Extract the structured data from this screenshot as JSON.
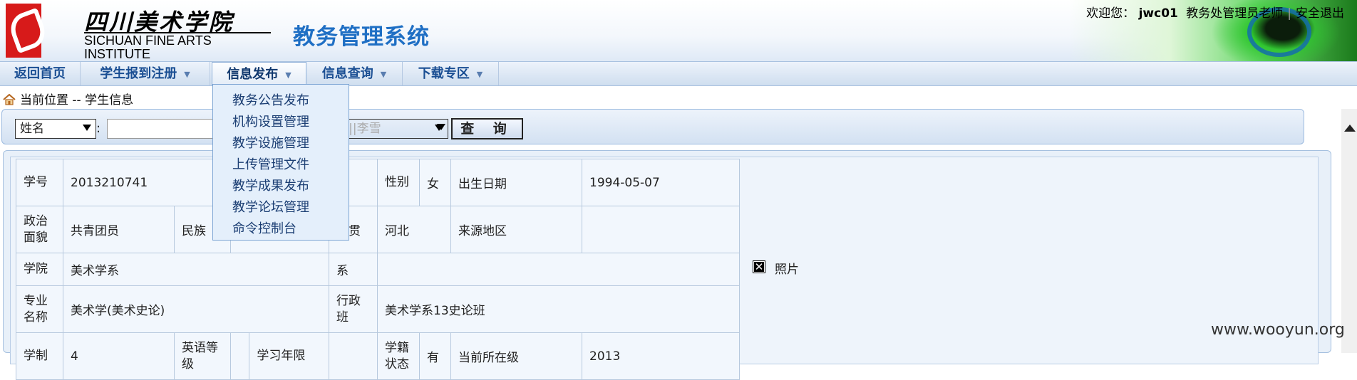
{
  "header": {
    "logo_cn": "四川美术学院",
    "logo_en": "SICHUAN FINE ARTS INSTITUTE",
    "system_title": "教务管理系统",
    "welcome_label": "欢迎您：",
    "user_name": "jwc01",
    "user_role": "教务处管理员老师",
    "separator": "|",
    "logout": "安全退出"
  },
  "nav": {
    "items": [
      {
        "label": "返回首页"
      },
      {
        "label": "学生报到注册",
        "arrow": "▼"
      },
      {
        "label": "信息发布",
        "arrow": "▼"
      },
      {
        "label": "信息查询",
        "arrow": "▼"
      },
      {
        "label": "下载专区",
        "arrow": "▼"
      }
    ]
  },
  "dropdown": {
    "items": [
      "教务公告发布",
      "机构设置管理",
      "教学设施管理",
      "上传管理文件",
      "教学成果发布",
      "教学论坛管理",
      "命令控制台"
    ]
  },
  "breadcrumb": "当前位置 -- 学生信息",
  "search": {
    "field_select": "姓名",
    "colon": ":",
    "student_select": "2013210741||李雪",
    "query_button": "查 询"
  },
  "student": {
    "rows": [
      [
        "学号",
        "2013210741",
        "",
        "性别",
        "女",
        "出生日期",
        "1994-05-07"
      ],
      [
        "政治面貌",
        "共青团员",
        "民族",
        "",
        "籍贯",
        "河北",
        "来源地区",
        ""
      ],
      [
        "学院",
        "美术学系",
        "系",
        ""
      ],
      [
        "专业名称",
        "美术学(美术史论)",
        "行政班",
        "美术学系13史论班"
      ],
      [
        "学制",
        "4",
        "英语等级",
        "",
        "学习年限",
        "",
        "学籍状态",
        "有",
        "当前所在级",
        "2013"
      ]
    ],
    "photo_label": "照片"
  },
  "watermark": "www.wooyun.org",
  "colors": {
    "nav_text": "#1a4e93",
    "title_blue": "#1f6fc4",
    "logo_red": "#d71a1a"
  }
}
